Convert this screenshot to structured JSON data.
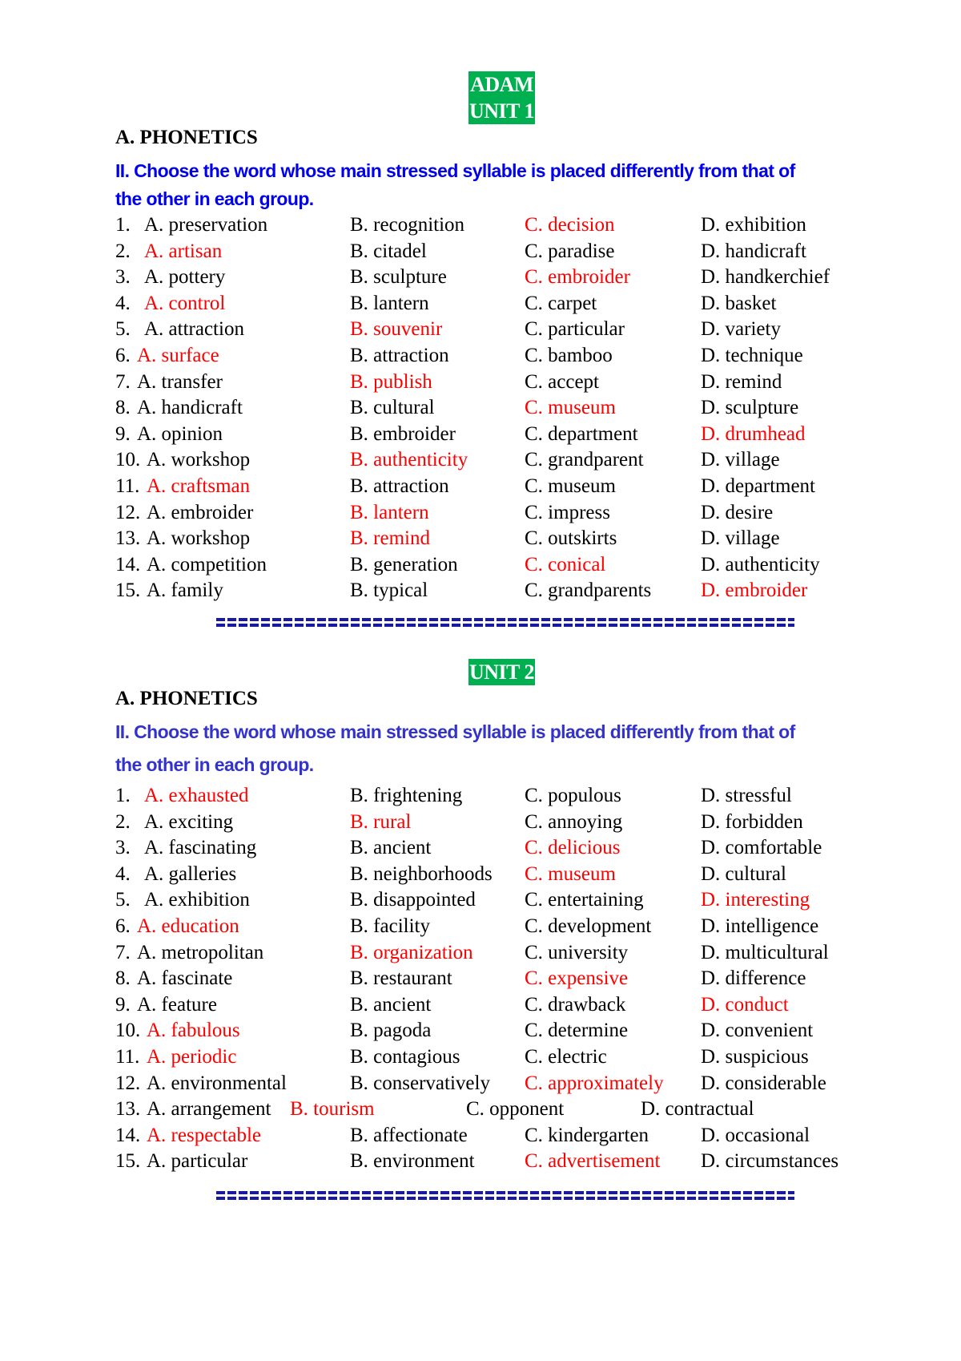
{
  "header": {
    "title_line1": "ADAM",
    "title_line2": "UNIT 1"
  },
  "colors": {
    "badge_bg": "#00b050",
    "instruction": "#0000ee",
    "correct_answer": "#ff0000",
    "separator": "#1a1aa0"
  },
  "units": [
    {
      "section": "A. PHONETICS",
      "instruction_line1": "II. Choose the word whose main stressed syllable is placed differently from that of",
      "instruction_line2": "the other in each group.",
      "questions": [
        {
          "num": "1.",
          "A": "A. preservation",
          "B": "B. recognition",
          "C": "C. decision",
          "D": "D. exhibition",
          "answer": "C"
        },
        {
          "num": "2.",
          "A": "A. artisan",
          "B": "B. citadel",
          "C": "C. paradise",
          "D": "D. handicraft",
          "answer": "A"
        },
        {
          "num": "3.",
          "A": "A. pottery",
          "B": "B. sculpture",
          "C": "C. embroider",
          "D": "D. handkerchief",
          "answer": "C"
        },
        {
          "num": "4.",
          "A": "A. control",
          "B": "B. lantern",
          "C": "C. carpet",
          "D": "D. basket",
          "answer": "A"
        },
        {
          "num": "5.",
          "A": "A. attraction",
          "B": "B. souvenir",
          "C": "C. particular",
          "D": "D. variety",
          "answer": "B"
        },
        {
          "num": "6.",
          "A": "A. surface",
          "B": "B. attraction",
          "C": "C. bamboo",
          "D": "D. technique",
          "answer": "A"
        },
        {
          "num": "7.",
          "A": "A. transfer",
          "B": "B. publish",
          "C": "C. accept",
          "D": "D. remind",
          "answer": "B"
        },
        {
          "num": "8.",
          "A": "A. handicraft",
          "B": "B. cultural",
          "C": "C. museum",
          "D": "D. sculpture",
          "answer": "C"
        },
        {
          "num": "9.",
          "A": "A. opinion",
          "B": "B. embroider",
          "C": "C. department",
          "D": "D. drumhead",
          "answer": "D"
        },
        {
          "num": "10.",
          "A": "A. workshop",
          "B": "B. authenticity",
          "C": "C. grandparent",
          "D": "D. village",
          "answer": "B"
        },
        {
          "num": "11.",
          "A": "A. craftsman",
          "B": "B. attraction",
          "C": "C. museum",
          "D": "D. department",
          "answer": "A"
        },
        {
          "num": "12.",
          "A": "A. embroider",
          "B": "B. lantern",
          "C": "C. impress",
          "D": "D. desire",
          "answer": "B"
        },
        {
          "num": "13.",
          "A": "A. workshop",
          "B": "B. remind",
          "C": "C. outskirts",
          "D": "D. village",
          "answer": "B"
        },
        {
          "num": "14.",
          "A": "A. competition",
          "B": "B. generation",
          "C": "C. conical",
          "D": "D. authenticity",
          "answer": "C"
        },
        {
          "num": "15.",
          "A": "A. family",
          "B": "B. typical",
          "C": "C. grandparents",
          "D": "D. embroider",
          "answer": "D"
        }
      ],
      "separator": "=================================================="
    },
    {
      "badge": "UNIT 2",
      "section": "A. PHONETICS",
      "instruction_line1": "II. Choose the word whose main stressed syllable is placed differently from that of",
      "instruction_line2": "the other in each group.",
      "questions": [
        {
          "num": "1.",
          "A": "A. exhausted",
          "B": "B. frightening",
          "C": "C. populous",
          "D": "D. stressful",
          "answer": "A"
        },
        {
          "num": "2.",
          "A": "A. exciting",
          "B": "B. rural",
          "C": "C. annoying",
          "D": "D. forbidden",
          "answer": "B"
        },
        {
          "num": "3.",
          "A": "A. fascinating",
          "B": "B. ancient",
          "C": "C. delicious",
          "D": "D. comfortable",
          "answer": "C"
        },
        {
          "num": "4.",
          "A": "A. galleries",
          "B": "B. neighborhoods",
          "C": "C. museum",
          "D": "D. cultural",
          "answer": "C"
        },
        {
          "num": "5.",
          "A": "A. exhibition",
          "B": "B. disappointed",
          "C": "C. entertaining",
          "D": "D. interesting",
          "answer": "D"
        },
        {
          "num": "6.",
          "A": "A. education",
          "B": "B. facility",
          "C": "C. development",
          "D": "D. intelligence",
          "answer": "A"
        },
        {
          "num": "7.",
          "A": "A. metropolitan",
          "B": "B. organization",
          "C": "C. university",
          "D": "D. multicultural",
          "answer": "B"
        },
        {
          "num": "8.",
          "A": "A. fascinate",
          "B": "B. restaurant",
          "C": "C. expensive",
          "D": "D. difference",
          "answer": "C"
        },
        {
          "num": "9.",
          "A": "A. feature",
          "B": "B. ancient",
          "C": "C. drawback",
          "D": "D. conduct",
          "answer": "D"
        },
        {
          "num": "10.",
          "A": "A. fabulous",
          "B": "B. pagoda",
          "C": "C. determine",
          "D": "D. convenient",
          "answer": "A"
        },
        {
          "num": "11.",
          "A": "A. periodic",
          "B": "B. contagious",
          "C": "C. electric",
          "D": "D. suspicious",
          "answer": "A"
        },
        {
          "num": "12.",
          "A": "A. environmental",
          "B": "B. conservatively",
          "C": "C. approximately",
          "D": "D. considerable",
          "answer": "C"
        },
        {
          "num": "13.",
          "A": "A. arrangement",
          "B": "B. tourism",
          "C": "C. opponent",
          "D": "D. contractual",
          "answer": "B"
        },
        {
          "num": "14.",
          "A": "A. respectable",
          "B": "B. affectionate",
          "C": "C. kindergarten",
          "D": "D. occasional",
          "answer": "A"
        },
        {
          "num": "15.",
          "A": "A. particular",
          "B": "B. environment",
          "C": "C. advertisement",
          "D": "D. circumstances",
          "answer": "C"
        }
      ],
      "separator": "=================================================="
    }
  ]
}
